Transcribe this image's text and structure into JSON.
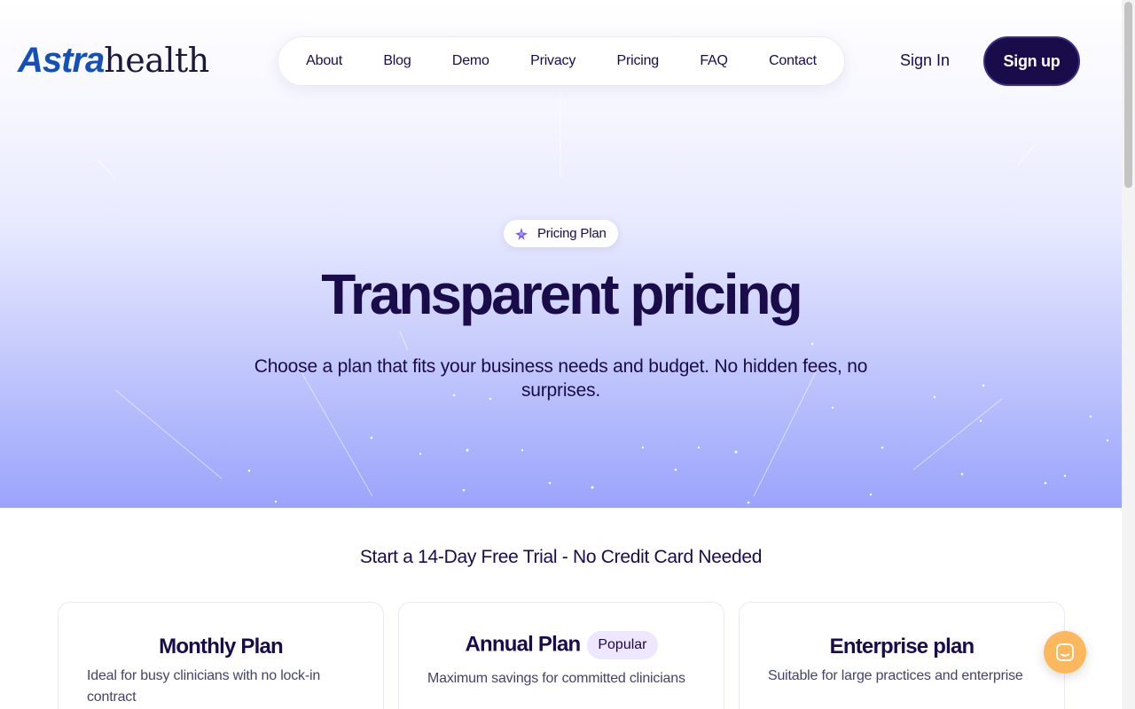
{
  "brand": {
    "mark": "Astra",
    "word": "health"
  },
  "nav": {
    "items": [
      "About",
      "Blog",
      "Demo",
      "Privacy",
      "Pricing",
      "FAQ",
      "Contact"
    ]
  },
  "auth": {
    "signin": "Sign In",
    "signup": "Sign up"
  },
  "hero": {
    "pill": "Pricing Plan",
    "title": "Transparent pricing",
    "subtitle": "Choose a plan that fits your business needs and budget. No hidden fees, no surprises."
  },
  "trial": "Start a 14-Day Free Trial - No Credit Card Needed",
  "plans": [
    {
      "title": "Monthly Plan",
      "desc": "Ideal for busy clinicians with no lock-in contract",
      "badge": ""
    },
    {
      "title": "Annual Plan",
      "desc": "Maximum savings for committed clinicians",
      "badge": "Popular"
    },
    {
      "title": "Enterprise plan",
      "desc": "Suitable for large practices and enterprise",
      "badge": ""
    }
  ],
  "colors": {
    "primary": "#1a0b4b",
    "brand_blue": "#1450b8",
    "chat": "#fdb75c",
    "badge_bg": "#efe6ff"
  },
  "icons": {
    "pill": "sparkle-icon",
    "chat": "chat-icon"
  }
}
